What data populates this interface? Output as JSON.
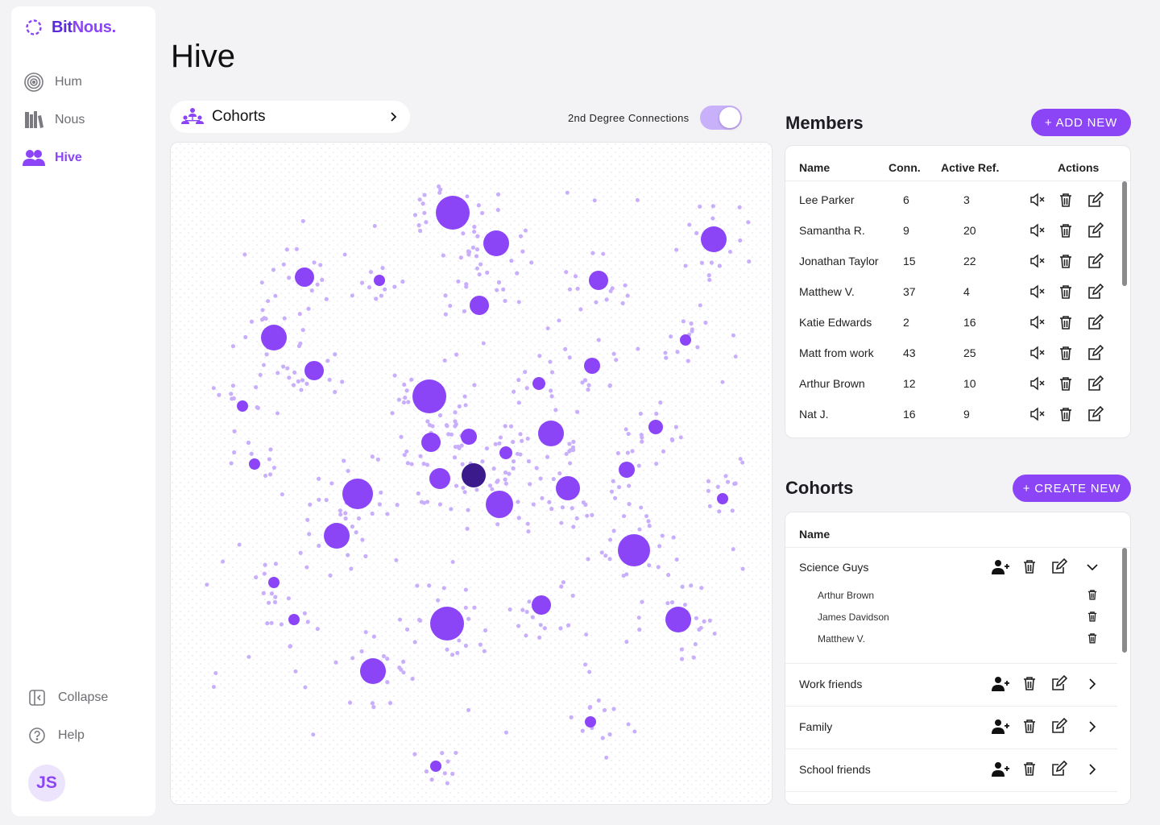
{
  "brand": {
    "part1": "Bit",
    "part2": "Nous."
  },
  "nav": {
    "items": [
      {
        "label": "Hum",
        "icon": "hum-icon",
        "active": false
      },
      {
        "label": "Nous",
        "icon": "books-icon",
        "active": false
      },
      {
        "label": "Hive",
        "icon": "people-icon",
        "active": true
      }
    ],
    "collapse": "Collapse",
    "help": "Help",
    "avatar": "JS"
  },
  "page": {
    "title": "Hive"
  },
  "graph_controls": {
    "cohort_select": "Cohorts",
    "toggle_label": "2nd Degree Connections",
    "toggle_on": true
  },
  "members": {
    "title": "Members",
    "add_button": "+ ADD NEW",
    "columns": {
      "name": "Name",
      "conn": "Conn.",
      "active": "Active Ref.",
      "actions": "Actions"
    },
    "rows": [
      {
        "name": "Lee Parker",
        "conn": "6",
        "active": "3"
      },
      {
        "name": "Samantha R.",
        "conn": "9",
        "active": "20"
      },
      {
        "name": "Jonathan Taylor",
        "conn": "15",
        "active": "22"
      },
      {
        "name": "Matthew V.",
        "conn": "37",
        "active": "4"
      },
      {
        "name": "Katie Edwards",
        "conn": "2",
        "active": "16"
      },
      {
        "name": "Matt from work",
        "conn": "43",
        "active": "25"
      },
      {
        "name": "Arthur Brown",
        "conn": "12",
        "active": "10"
      },
      {
        "name": "Nat J.",
        "conn": "16",
        "active": "9"
      }
    ]
  },
  "cohorts": {
    "title": "Cohorts",
    "create_button": "+ CREATE NEW",
    "column_name": "Name",
    "expanded": {
      "name": "Science Guys",
      "members": [
        "Arthur Brown",
        "James Davidson",
        "Matthew V."
      ]
    },
    "rows": [
      {
        "name": "Work friends"
      },
      {
        "name": "Family"
      },
      {
        "name": "School friends"
      }
    ]
  },
  "colors": {
    "accent": "#8b45f7",
    "accent_dark": "#3b1a8c",
    "satellite": "#c9aefc"
  }
}
